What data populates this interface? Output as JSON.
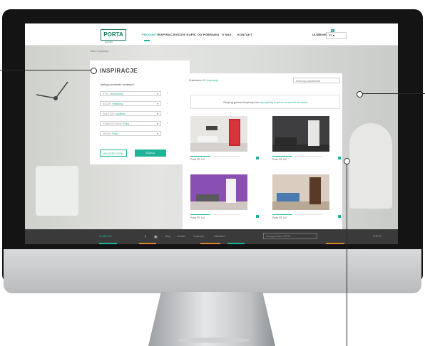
{
  "header": {
    "logo_text": "PORTA",
    "logo_sub": "DOORS",
    "nav": [
      "PRODUKTY",
      "INSPIRACJE",
      "GDZIE KUPIĆ",
      "DO POBRANIA",
      "O NAS",
      "KONTAKT"
    ],
    "active_nav": "PRODUKTY",
    "cart_label": "ULUBIONE",
    "cart_count": "3",
    "language": "PL"
  },
  "breadcrumb": "Start  /  Inspiracje",
  "filter": {
    "title": "INSPIRACJE",
    "question": "Jakiego produktu szukasz?",
    "fields": [
      {
        "label": "STYL:",
        "value": "Nowoczesny"
      },
      {
        "label": "KOLOR:",
        "value": "Pastelowy"
      },
      {
        "label": "WNĘTRZE:",
        "value": "Sypialnia"
      },
      {
        "label": "POMIESZCZENIE:",
        "value": "Pokój"
      },
      {
        "label": "DRZWI:",
        "value": "Pokój"
      }
    ],
    "reset_label": "WYCZYŚĆ FILTRY",
    "submit_label": "SZUKAJ"
  },
  "results": {
    "count_prefix": "Znaleziono",
    "count_value": "32 inspiracje",
    "sort_label": "Sortuj wg: popularności",
    "promo_text": "Obejrzyj gotowe inspiracje lub",
    "promo_link": "zaprojektuj wnętrze ze swoimi drzwiami",
    "cards": [
      {
        "caption": "Porta FIT, A.0"
      },
      {
        "caption": "Porta FIT, A.0"
      },
      {
        "caption": "Porta FIT, A.0"
      },
      {
        "caption": "Porta FIT, A.0"
      }
    ]
  },
  "bottom_bar": {
    "active": "ULUBIONE",
    "items": [
      "Blog",
      "Kontakt",
      "Inspiracje",
      "Kalkulator"
    ],
    "search_placeholder": "Szukaj produktu PORTA",
    "right_text": "PORTA"
  },
  "colors": {
    "accent": "#1fb39a",
    "logo": "#1a7a5f",
    "monitor_frame": "#141414",
    "bottom_bar": "#3a3a3a"
  }
}
